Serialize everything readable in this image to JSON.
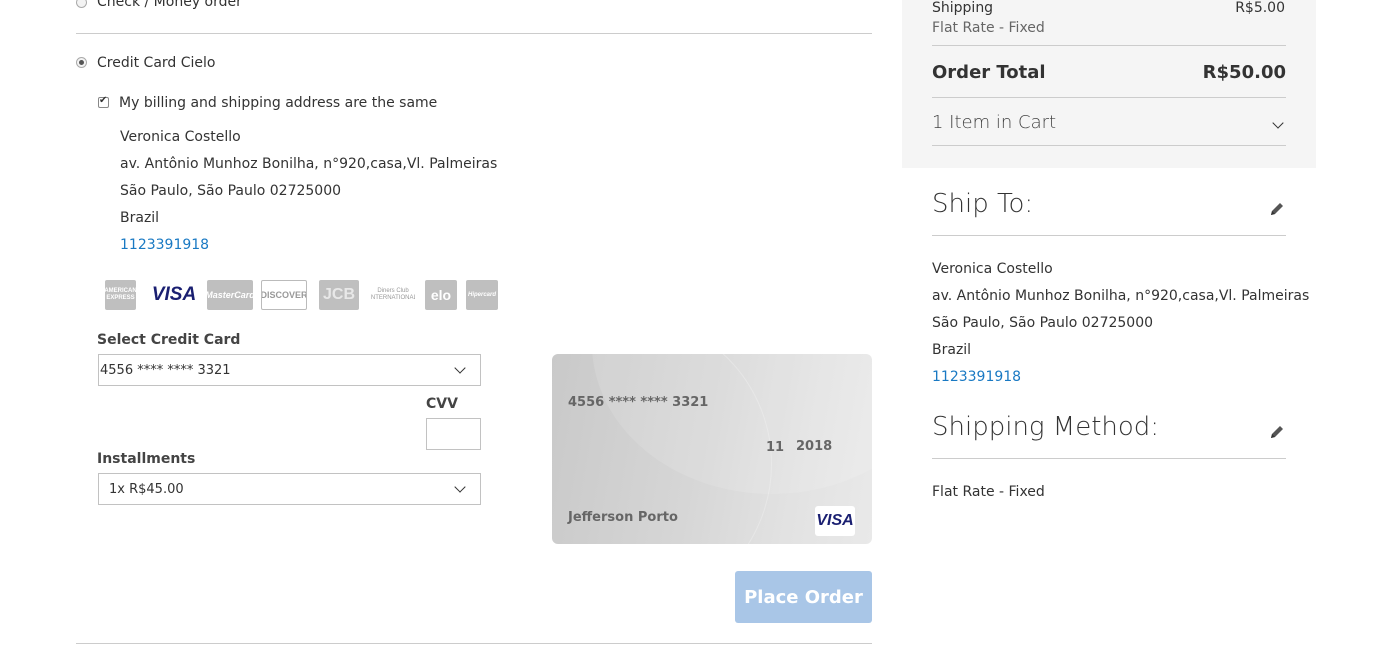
{
  "payment": {
    "check_money_label": "Check / Money order",
    "credit_card_label": "Credit Card Cielo",
    "same_address_label": "My billing and shipping address are the same",
    "billing_address": {
      "name": "Veronica Costello",
      "street": "av. Antônio Munhoz Bonilha, n°920,casa,Vl. Palmeiras",
      "city_line": "São Paulo, São Paulo 02725000",
      "country": "Brazil",
      "phone": "1123391918"
    },
    "card_logos": [
      {
        "name": "amex-logo",
        "text": "AMERICAN EXPRESS"
      },
      {
        "name": "visa-logo",
        "text": "VISA"
      },
      {
        "name": "mastercard-logo",
        "text": "MasterCard"
      },
      {
        "name": "discover-logo",
        "text": "DISCOVER"
      },
      {
        "name": "jcb-logo",
        "text": "JCB"
      },
      {
        "name": "diners-logo",
        "text": "Diners Club INTERNATIONAL"
      },
      {
        "name": "elo-logo",
        "text": "elo"
      },
      {
        "name": "hipercard-logo",
        "text": "Hipercard"
      }
    ],
    "select_card_label": "Select Credit Card",
    "select_card_value": "4556 **** **** 3321",
    "cvv_label": "CVV",
    "installments_label": "Installments",
    "installments_value": "1x R$45.00",
    "card_preview": {
      "number": "4556 **** **** 3321",
      "exp_month": "11",
      "exp_year": "2018",
      "holder": "Jefferson Porto",
      "brand": "VISA"
    },
    "place_order_label": "Place Order"
  },
  "summary": {
    "shipping_label": "Shipping",
    "shipping_value": "R$5.00",
    "shipping_method_sub": "Flat Rate - Fixed",
    "order_total_label": "Order Total",
    "order_total_value": "R$50.00",
    "items_in_cart": "1 Item in Cart"
  },
  "ship_to": {
    "title": "Ship To:",
    "name": "Veronica Costello",
    "street": "av. Antônio Munhoz Bonilha, n°920,casa,Vl. Palmeiras",
    "city_line": "São Paulo, São Paulo 02725000",
    "country": "Brazil",
    "phone": "1123391918"
  },
  "shipping_method": {
    "title": "Shipping Method:",
    "value": "Flat Rate - Fixed"
  },
  "colors": {
    "link": "#1979c3",
    "button": "#a9c6e7",
    "summary_bg": "#f5f5f5"
  }
}
